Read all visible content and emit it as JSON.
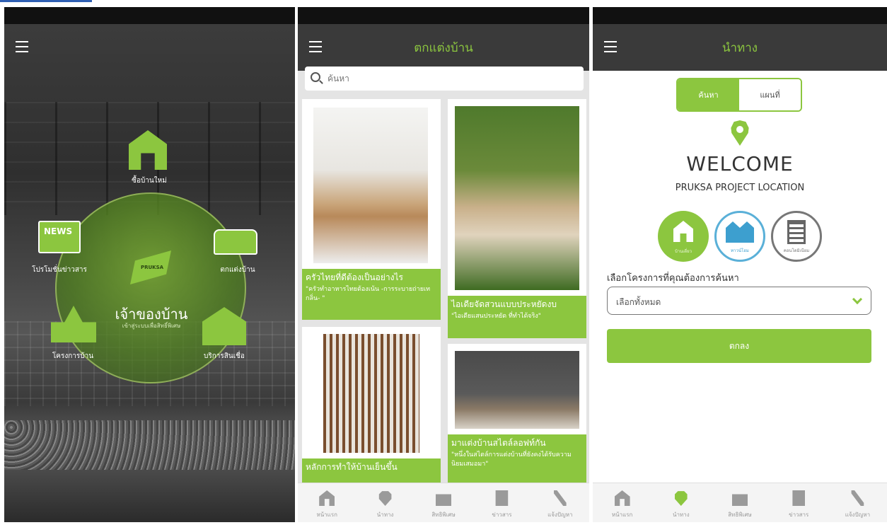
{
  "panel_home": {
    "center_title": "เจ้าของบ้าน",
    "center_subtitle": "เข้าสู่ระบบเพื่อสิทธิ์พิเศษ",
    "logo_text": "PRUKSA",
    "news_badge": "NEWS",
    "menu": [
      {
        "label": "ซื้อบ้านใหม่",
        "icon": "house-icon"
      },
      {
        "label": "โปรโมชั่นข่าวสาร",
        "icon": "news-icon"
      },
      {
        "label": "ตกแต่งบ้าน",
        "icon": "sofa-icon"
      },
      {
        "label": "โครงการบ้าน",
        "icon": "map-pin-icon"
      },
      {
        "label": "บริการสินเชื่อ",
        "icon": "loan-tag-icon"
      }
    ]
  },
  "panel_decor": {
    "title": "ตกแต่งบ้าน",
    "search_placeholder": "ค้นหา",
    "articles": [
      {
        "title": "ครัวไทยที่ดีต้องเป็นอย่างไร",
        "desc": "\"ครัวทำอาหารไทยต้องเน้น -การระบายถ่ายเทกลิ่น- \""
      },
      {
        "title": "ไอเดียจัดสวนแบบประหยัดงบ",
        "desc": "\"ไอเดียแสนประหยัด ที่ทำได้จริง\""
      },
      {
        "title": "หลักการทำให้บ้านเย็นขึ้น",
        "desc": ""
      },
      {
        "title": "มาแต่งบ้านสไตล์ลอฟท์กัน",
        "desc": "\"หนึ่งในสไตล์การแต่งบ้านที่ยังคงได้รับความนิยมเสมอมา\""
      }
    ]
  },
  "panel_nav": {
    "title": "นำทาง",
    "seg_search": "ค้นหา",
    "seg_map": "แผนที่",
    "welcome": "WELCOME",
    "subtitle": "PRUKSA PROJECT LOCATION",
    "types": [
      "บ้านเดี่ยว",
      "ทาวน์โฮม",
      "คอนโดมิเนียม"
    ],
    "select_label": "เลือกโครงการที่คุณต้องการค้นหา",
    "dropdown_value": "เลือกทั้งหมด",
    "ok_button": "ตกลง"
  },
  "tabbar": {
    "tabs": [
      "หน้าแรก",
      "นำทาง",
      "สิทธิพิเศษ",
      "ข่าวสาร",
      "แจ้งปัญหา"
    ]
  },
  "colors": {
    "accent": "#8cc63f",
    "appbar": "#3a3a3a",
    "statusbar": "#111111"
  }
}
